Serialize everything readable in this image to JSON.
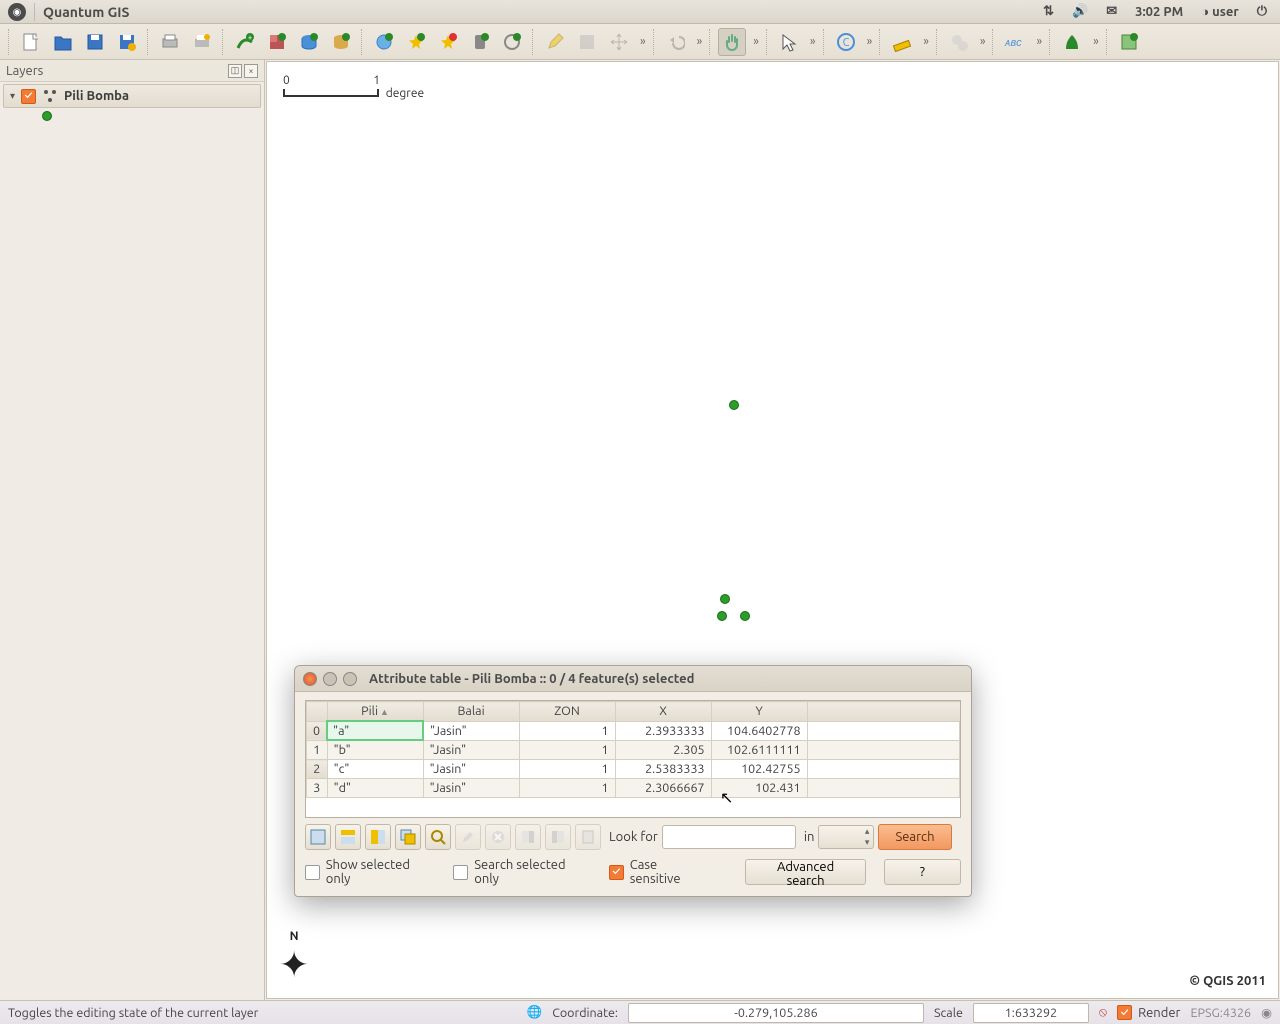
{
  "menubar": {
    "app_title": "Quantum GIS",
    "time": "3:02 PM",
    "user": "user"
  },
  "layers_panel": {
    "title": "Layers",
    "items": [
      {
        "name": "Pili Bomba",
        "checked": true
      }
    ]
  },
  "canvas": {
    "scale_start": "0",
    "scale_end": "1",
    "scale_unit": "degree",
    "copyright": "© QGIS 2011",
    "north_label": "N"
  },
  "dialog": {
    "title": "Attribute table - Pili Bomba :: 0 / 4 feature(s) selected",
    "columns": [
      "Pili",
      "Balai",
      "ZON",
      "X",
      "Y"
    ],
    "rows": [
      {
        "idx": "0",
        "pili": "\"a\"",
        "balai": "\"Jasin\"",
        "zon": "1",
        "x": "2.3933333",
        "y": "104.6402778"
      },
      {
        "idx": "1",
        "pili": "\"b\"",
        "balai": "\"Jasin\"",
        "zon": "1",
        "x": "2.305",
        "y": "102.6111111"
      },
      {
        "idx": "2",
        "pili": "\"c\"",
        "balai": "\"Jasin\"",
        "zon": "1",
        "x": "2.5383333",
        "y": "102.42755"
      },
      {
        "idx": "3",
        "pili": "\"d\"",
        "balai": "\"Jasin\"",
        "zon": "1",
        "x": "2.3066667",
        "y": "102.431"
      }
    ],
    "look_for_label": "Look for",
    "in_label": "in",
    "search_label": "Search",
    "show_selected_label": "Show selected only",
    "search_selected_label": "Search selected only",
    "case_sensitive_label": "Case sensitive",
    "advanced_label": "Advanced search",
    "help_label": "?"
  },
  "status": {
    "hint": "Toggles the editing state of the current layer",
    "coord_label": "Coordinate:",
    "coord_value": "-0.279,105.286",
    "extents_tip": "🌐",
    "scale_label": "Scale",
    "scale_value": "1:633292",
    "render_label": "Render",
    "crs": "EPSG:4326"
  }
}
